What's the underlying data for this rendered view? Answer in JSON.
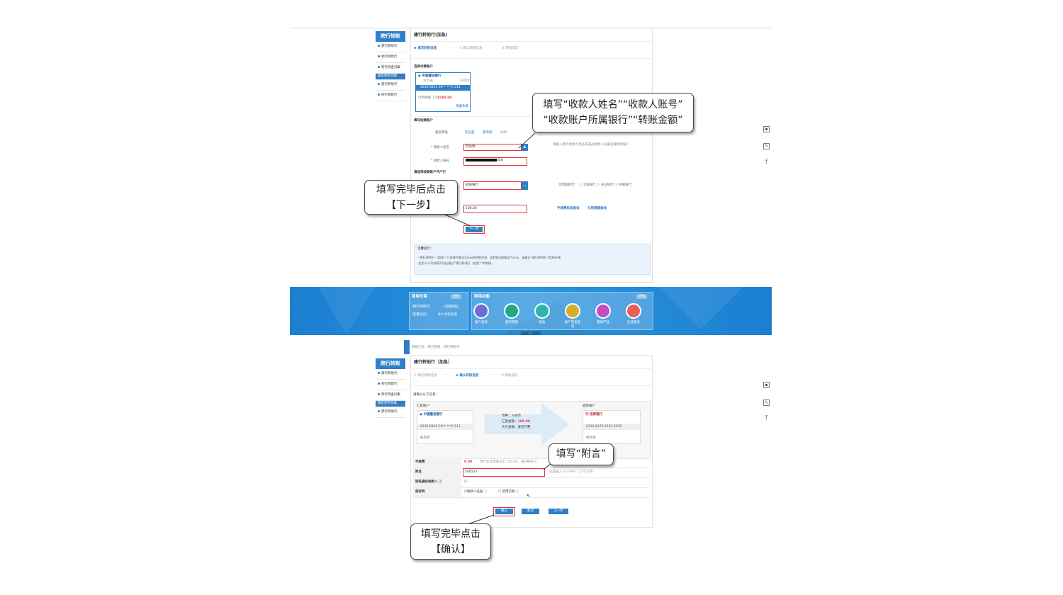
{
  "top": {
    "side_title": "跨行转账",
    "side_items": [
      "建行转他行",
      "他行转建行",
      "跨行资金归集"
    ],
    "side_highlight": "最近使用功能",
    "side_recent": [
      "建行转他行",
      "他行转建行"
    ],
    "page_title": "建行转他行(加急)",
    "steps": [
      "填写转账信息",
      "确认转账信息",
      "转账成功"
    ],
    "choose_payer_label": "选择付款账户",
    "card_bank": "中国建设银行",
    "card_type": "龙卡通",
    "card_status": "已签约",
    "card_number": "6236 6819 30** ***0 511",
    "balance_label": "可用余额（元）",
    "balance_value": "1585.00",
    "hide_balance": "隐藏余额",
    "payee_section": "填写收款账户",
    "recent_label": "最近转账",
    "recent_names": [
      "陈启超",
      "曹荣楠",
      "LOR"
    ],
    "name_label": "收款人姓名",
    "name_value": "何达地",
    "account_label": "收款人账号",
    "account_value": "356",
    "hint": "请输入他行收款人姓名或通过收款人名册选择收款账户",
    "bank_section": "请选择收款账户开户行",
    "bank_value": "招商银行",
    "common_banks_label": "常用收款行：",
    "common_banks": [
      "工商银行",
      "农业银行",
      "中国银行"
    ],
    "amount_value": "100.00",
    "fee_link": "手续费标准查询",
    "limit_link": "交易限额查询",
    "next_button": "下一步",
    "tip_title": "温馨提示：",
    "tip_lines": [
      "·“建行转他行（加急）”只处理不超过5万元的转账交易，如转账金额超过5万元，请通过“建行转他行”菜单办理。",
      "·信用卡卡号仅限不包括通过“建行转他行（加急）”的转账。"
    ]
  },
  "bar": {
    "common_tx_title": "常用交易",
    "more": "更多",
    "common_tx_items": [
      "[建行转建行]",
      "[活期转账]",
      "[签署协议]",
      "本人手机充值"
    ],
    "common_fn_title": "常用功能",
    "custom": "定制",
    "functions": [
      "账户查询",
      "建行转账",
      "基金",
      "账户资金查询",
      "理财产品",
      "生活服务"
    ]
  },
  "bottom": {
    "breadcrumb": "转账汇款 › 跨行转账 › 建行转他行",
    "side_title": "跨行转账",
    "side_items": [
      "建行转他行",
      "他行转建行",
      "跨行资金归集"
    ],
    "side_highlight": "最近使用功能",
    "side_recent": [
      "建行转他行"
    ],
    "page_title": "建行转他行（加急）",
    "steps": [
      "填写转账信息",
      "确认转账信息",
      "转账成功"
    ],
    "confirm_prompt": "请确认以下信息：",
    "payer_label": "汇款账户",
    "payer_bank": "中国建设银行",
    "payer_number": "6236 6819 30** ***0 511",
    "payer_holder": "陈启然",
    "currency": "币种：人民币",
    "amount_label": "汇款金额：",
    "amount_value": "100.00",
    "amount_upper": "大写金额：壹佰元整",
    "payee_label": "收款账户",
    "payee_bank": "招商银行",
    "payee_number": "6214 8376 9329 3058",
    "payee_holder": "何达地",
    "fee_label": "手续费",
    "fee_value": "0.00",
    "fee_note": "预计本次转账支出 100.00，请仔细核对",
    "memo_label": "附言",
    "memo_value": "546553",
    "memo_note": "还能输入24个字符（12个汉字）",
    "sms_label": "短信通知收款人",
    "save_label": "保存到",
    "save_opt1": "收款人名册",
    "save_opt2": "常用交易",
    "confirm_button": "确认",
    "cancel_button": "取消",
    "prev_button": "上一步"
  },
  "callouts": {
    "c1_line1": "填写“收款人姓名”“收款人账号”",
    "c1_line2": "“收款账户所属银行”“转账金额”",
    "c2_line1": "填写完毕后点击",
    "c2_line2": "【下一步】",
    "c3": "填写“附言”",
    "c4_line1": "填写完毕点击",
    "c4_line2": "【确认】"
  }
}
